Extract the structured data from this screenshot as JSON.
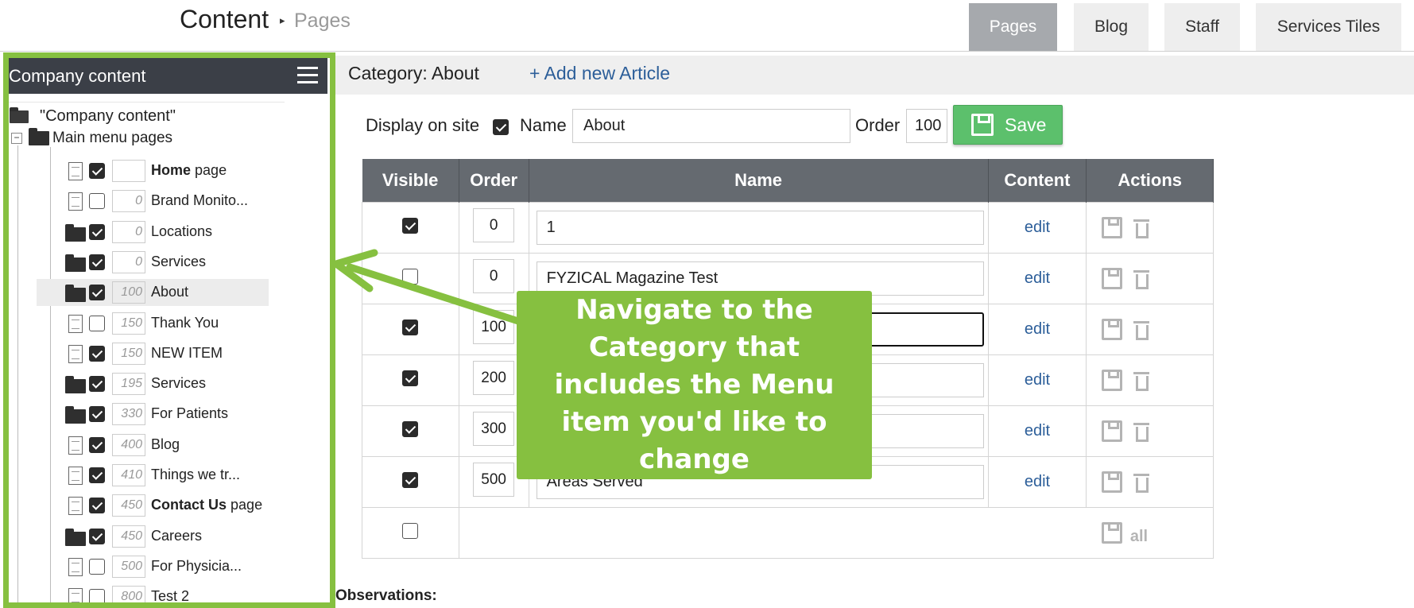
{
  "header": {
    "title": "Content",
    "breadcrumb_sep": "▸",
    "breadcrumb": "Pages",
    "tabs": [
      {
        "label": "Pages",
        "active": true
      },
      {
        "label": "Blog",
        "active": false
      },
      {
        "label": "Staff",
        "active": false
      },
      {
        "label": "Services Tiles",
        "active": false
      }
    ]
  },
  "sidebar": {
    "title": "Company content",
    "root_label": "\"Company content\"",
    "main_label": "Main menu pages",
    "items": [
      {
        "icon": "page",
        "checked": true,
        "order": "",
        "label": "page",
        "bold": "Home"
      },
      {
        "icon": "page",
        "checked": false,
        "order": "0",
        "label": "Brand Monito..."
      },
      {
        "icon": "folder",
        "checked": true,
        "order": "0",
        "label": "Locations"
      },
      {
        "icon": "folder",
        "checked": true,
        "order": "0",
        "label": "Services"
      },
      {
        "icon": "folder",
        "checked": true,
        "order": "100",
        "label": "About",
        "selected": true
      },
      {
        "icon": "page",
        "checked": false,
        "order": "150",
        "label": "Thank You"
      },
      {
        "icon": "page",
        "checked": true,
        "order": "150",
        "label": "NEW ITEM"
      },
      {
        "icon": "folder",
        "checked": true,
        "order": "195",
        "label": "Services"
      },
      {
        "icon": "folder",
        "checked": true,
        "order": "330",
        "label": "For Patients"
      },
      {
        "icon": "page",
        "checked": true,
        "order": "400",
        "label": "Blog"
      },
      {
        "icon": "page",
        "checked": true,
        "order": "410",
        "label": "Things we tr..."
      },
      {
        "icon": "page",
        "checked": true,
        "order": "450",
        "label": "page",
        "bold": "Contact Us"
      },
      {
        "icon": "folder",
        "checked": true,
        "order": "450",
        "label": "Careers"
      },
      {
        "icon": "page",
        "checked": false,
        "order": "500",
        "label": "For Physicia..."
      },
      {
        "icon": "page",
        "checked": false,
        "order": "800",
        "label": "Test 2"
      }
    ]
  },
  "category": {
    "label": "Category: About",
    "add_link": "+ Add new Article"
  },
  "form": {
    "display_label": "Display on site",
    "display_checked": true,
    "name_label": "Name",
    "name_value": "About",
    "order_label": "Order",
    "order_value": "100",
    "save_label": "Save"
  },
  "table": {
    "headers": {
      "visible": "Visible",
      "order": "Order",
      "name": "Name",
      "content": "Content",
      "actions": "Actions"
    },
    "rows": [
      {
        "visible": true,
        "order": "0",
        "name": "1",
        "content": "edit"
      },
      {
        "visible": false,
        "order": "0",
        "name": "FYZICAL Magazine Test",
        "content": "edit"
      },
      {
        "visible": true,
        "order": "100",
        "name": "",
        "content": "edit",
        "focused": true
      },
      {
        "visible": true,
        "order": "200",
        "name": "",
        "content": "edit"
      },
      {
        "visible": true,
        "order": "300",
        "name": "",
        "content": "edit"
      },
      {
        "visible": true,
        "order": "500",
        "name": "Areas Served",
        "content": "edit"
      }
    ],
    "footer_all": "all"
  },
  "observations_label": "Observations:",
  "callout": {
    "text": "Navigate to the Category that includes the Menu item you'd like to change"
  },
  "colors": {
    "highlight_green": "#86c040",
    "save_green": "#5cc06c",
    "header_dark": "#3b3f47",
    "table_header": "#656a70",
    "link_blue": "#2c5e99"
  }
}
